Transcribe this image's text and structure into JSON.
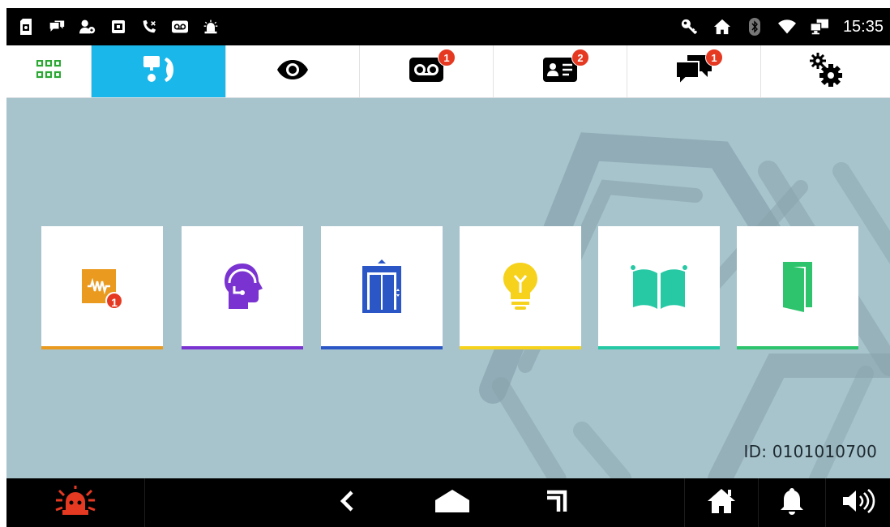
{
  "status_bar": {
    "left_icons": [
      "sd-card-icon",
      "messages-icon",
      "add-user-icon",
      "scene-icon",
      "missed-call-icon",
      "voicemail-icon",
      "alarm-icon"
    ],
    "right_icons": [
      "key-icon",
      "home-icon",
      "bluetooth-icon",
      "wifi-icon",
      "monitor-icon"
    ],
    "time": "15:35"
  },
  "tabs": [
    {
      "name": "apps",
      "icon": "grid-icon",
      "badge": ""
    },
    {
      "name": "intercom",
      "icon": "intercom-icon",
      "badge": "",
      "active": true
    },
    {
      "name": "monitor",
      "icon": "eye-icon",
      "badge": ""
    },
    {
      "name": "voicemail",
      "icon": "voicemail-icon",
      "badge": "1"
    },
    {
      "name": "contacts",
      "icon": "contact-card-icon",
      "badge": "2"
    },
    {
      "name": "messages",
      "icon": "chat-icon",
      "badge": "1"
    },
    {
      "name": "settings",
      "icon": "gears-icon",
      "badge": ""
    }
  ],
  "tiles": [
    {
      "name": "audio-message",
      "icon": "audio-wave-icon",
      "color": "#e99a1f",
      "badge": "1"
    },
    {
      "name": "concierge",
      "icon": "headset-person-icon",
      "color": "#7a33d1",
      "badge": ""
    },
    {
      "name": "elevator",
      "icon": "elevator-icon",
      "color": "#2b57c6",
      "badge": ""
    },
    {
      "name": "light",
      "icon": "lightbulb-icon",
      "color": "#f6d21c",
      "badge": ""
    },
    {
      "name": "gate",
      "icon": "gate-icon",
      "color": "#27c9a5",
      "badge": ""
    },
    {
      "name": "door",
      "icon": "door-icon",
      "color": "#2ec46d",
      "badge": ""
    }
  ],
  "device_id": "ID: 0101010700",
  "nav_bar": {
    "icons": [
      "alarm-icon",
      "back-icon",
      "home-icon",
      "recent-icon",
      "home-icon",
      "bell-icon",
      "volume-icon"
    ],
    "alarm_color": "#e53922"
  }
}
